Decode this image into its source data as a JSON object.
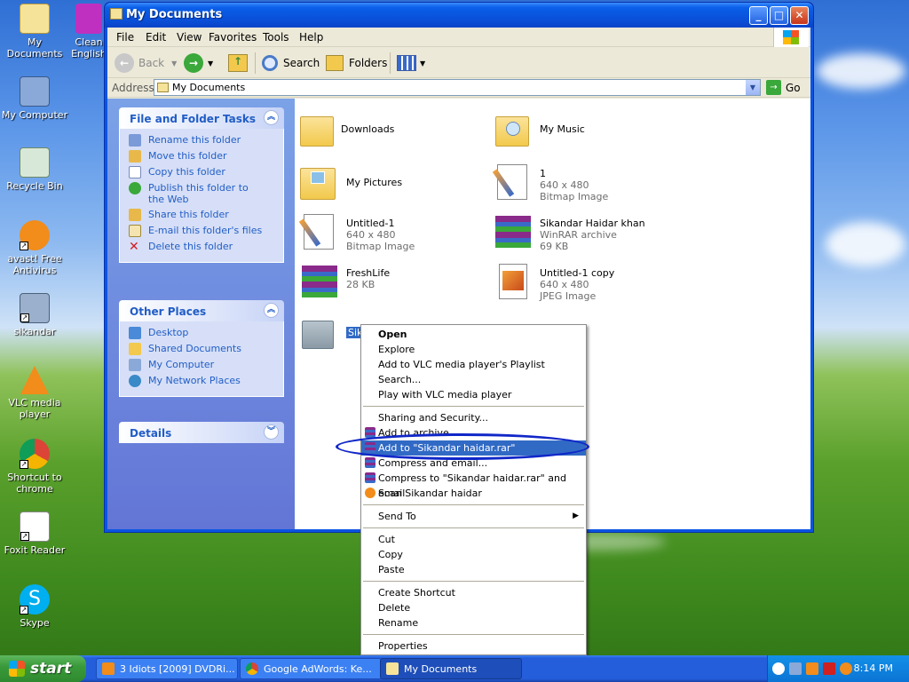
{
  "desktop": {
    "icons": [
      {
        "label": "My Documents",
        "icon": "my-documents-icon"
      },
      {
        "label": "Clean English",
        "icon": "clean-english-icon"
      },
      {
        "label": "My Computer",
        "icon": "my-computer-icon"
      },
      {
        "label": "Recycle Bin",
        "icon": "recycle-bin-icon"
      },
      {
        "label": "avast! Free Antivirus",
        "icon": "avast-icon"
      },
      {
        "label": "sikandar",
        "icon": "sikandar-icon"
      },
      {
        "label": "VLC media player",
        "icon": "vlc-icon"
      },
      {
        "label": "Shortcut to chrome",
        "icon": "chrome-icon"
      },
      {
        "label": "Foxit Reader",
        "icon": "foxit-icon"
      },
      {
        "label": "Skype",
        "icon": "skype-icon"
      }
    ]
  },
  "window": {
    "title": "My Documents",
    "menu": [
      "File",
      "Edit",
      "View",
      "Favorites",
      "Tools",
      "Help"
    ],
    "toolbar": {
      "back": "Back",
      "search": "Search",
      "folders": "Folders"
    },
    "address": {
      "label": "Address",
      "value": "My Documents",
      "go": "Go"
    }
  },
  "left_pane": {
    "file_tasks": {
      "title": "File and Folder Tasks",
      "items": [
        "Rename this folder",
        "Move this folder",
        "Copy this folder",
        "Publish this folder to the Web",
        "Share this folder",
        "E-mail this folder's files",
        "Delete this folder"
      ]
    },
    "other_places": {
      "title": "Other Places",
      "items": [
        "Desktop",
        "Shared Documents",
        "My Computer",
        "My Network Places"
      ]
    },
    "details": {
      "title": "Details"
    }
  },
  "files": [
    {
      "name": "Downloads",
      "sub1": "",
      "sub2": ""
    },
    {
      "name": "My Music",
      "sub1": "",
      "sub2": ""
    },
    {
      "name": "My Pictures",
      "sub1": "",
      "sub2": ""
    },
    {
      "name": "1",
      "sub1": "640 x 480",
      "sub2": "Bitmap Image"
    },
    {
      "name": "Untitled-1",
      "sub1": "640 x 480",
      "sub2": "Bitmap Image"
    },
    {
      "name": "Sikandar Haidar khan",
      "sub1": "WinRAR archive",
      "sub2": "69 KB"
    },
    {
      "name": "FreshLife",
      "sub1": "28 KB",
      "sub2": ""
    },
    {
      "name": "Untitled-1 copy",
      "sub1": "640 x 480",
      "sub2": "JPEG Image"
    },
    {
      "name": "Sikandar haidar",
      "sub1": "",
      "sub2": ""
    }
  ],
  "context_menu": {
    "group1": [
      "Open",
      "Explore",
      "Add to VLC media player's Playlist",
      "Search...",
      "Play with VLC media player"
    ],
    "group2": [
      "Sharing and Security...",
      "Add to archive...",
      "Add to \"Sikandar haidar.rar\"",
      "Compress and email...",
      "Compress to \"Sikandar haidar.rar\" and email",
      "Scan Sikandar haidar"
    ],
    "group3": [
      "Send To"
    ],
    "group4": [
      "Cut",
      "Copy",
      "Paste"
    ],
    "group5": [
      "Create Shortcut",
      "Delete",
      "Rename"
    ],
    "group6": [
      "Properties"
    ]
  },
  "taskbar": {
    "start": "start",
    "buttons": [
      "3 Idiots [2009] DVDRi...",
      "Google AdWords: Ke...",
      "My Documents"
    ],
    "clock": "8:14 PM"
  },
  "colors": {
    "highlight": "#316ac5",
    "annotation": "#1027c8",
    "link": "#215dc6"
  }
}
